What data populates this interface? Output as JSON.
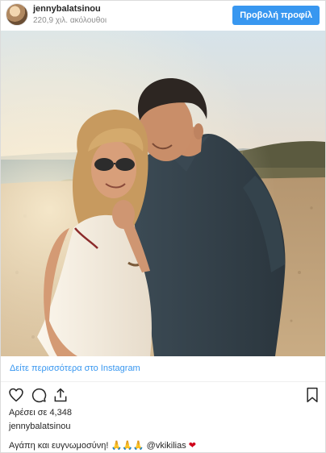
{
  "header": {
    "username": "jennybalatsinou",
    "followers": "220,9 χιλ. ακόλουθοι",
    "view_profile_label": "Προβολή προφίλ"
  },
  "photo": {
    "subject": "couple-portrait"
  },
  "more_link": "Δείτε περισσότερα στο Instagram",
  "actions": {
    "icons": [
      "heart-icon",
      "comment-icon",
      "share-icon",
      "bookmark-icon"
    ]
  },
  "likes": "Αρέσει σε 4,348",
  "author": "jennybalatsinou",
  "caption": {
    "text": "Αγάπη και ευγνωμοσύνη!",
    "emojis": "🙏🙏🙏",
    "mention": "@vkikilias",
    "heart": "❤"
  },
  "colors": {
    "accent": "#3897f0",
    "text": "#262626",
    "muted": "#8e8e8e",
    "heart": "#d0021b"
  }
}
